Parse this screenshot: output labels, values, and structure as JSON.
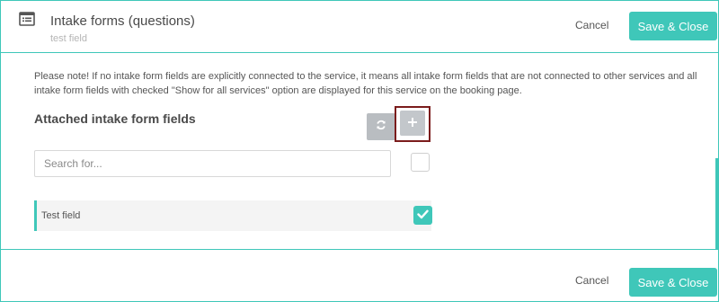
{
  "header": {
    "title": "Intake forms (questions)",
    "subtitle": "test field",
    "icon": "list-window-icon",
    "cancel_label": "Cancel",
    "save_label": "Save & Close"
  },
  "main": {
    "note": "Please note! If no intake form fields are explicitly connected to the service, it means all intake form fields that are not connected to other services and all intake form fields with checked \"Show for all services\" option are displayed for this service on the booking page.",
    "section_title": "Attached intake form fields",
    "refresh_icon": "refresh-icon",
    "add_icon": "plus-icon",
    "search": {
      "placeholder": "Search for...",
      "value": ""
    },
    "select_all_checked": false,
    "fields": [
      {
        "label": "Test field",
        "checked": true
      }
    ]
  },
  "footer": {
    "cancel_label": "Cancel",
    "save_label": "Save & Close"
  },
  "colors": {
    "accent": "#3fc7b9",
    "highlight_border": "#7b1c1c",
    "icon_button": "#b9bdc1"
  }
}
